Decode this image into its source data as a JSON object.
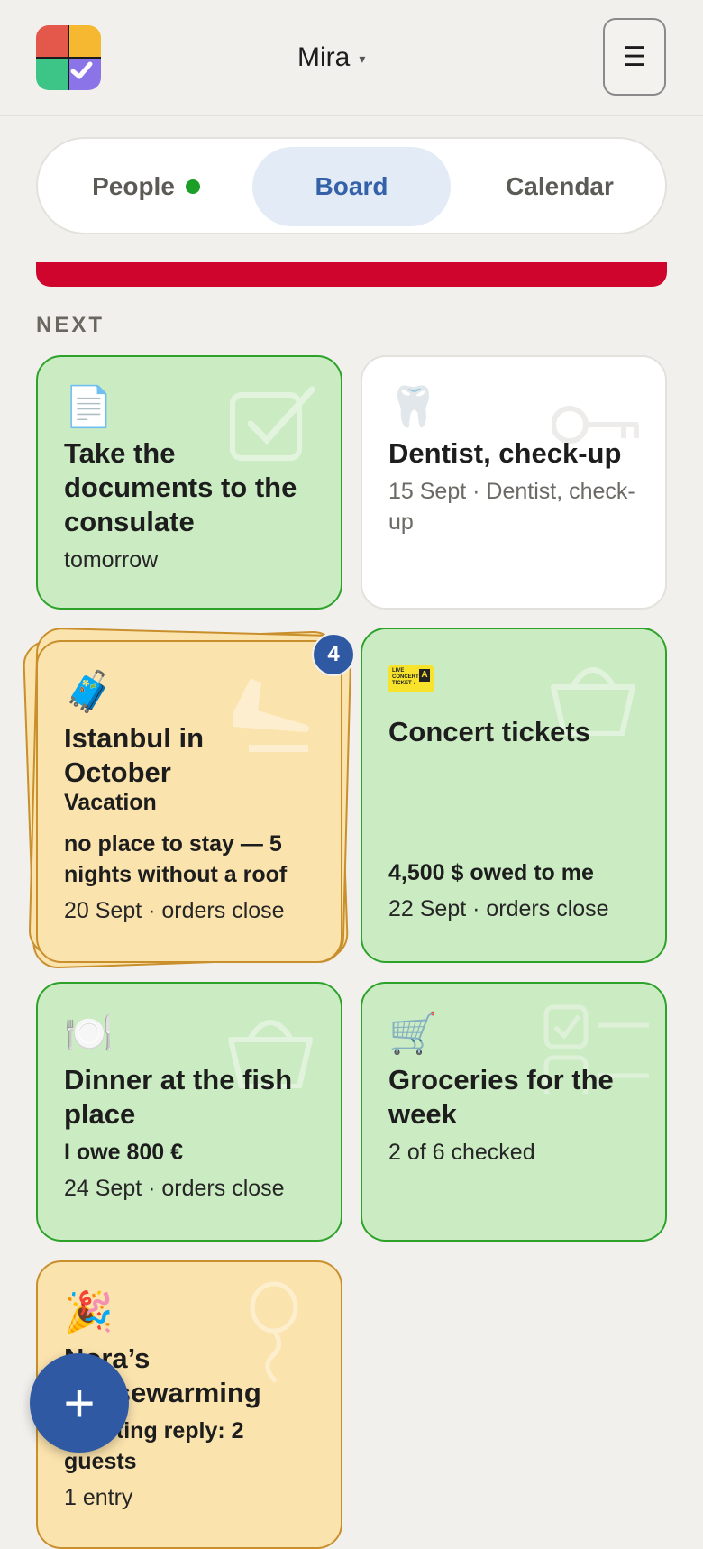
{
  "header": {
    "user_name": "Mira",
    "caret": "▾",
    "menu_icon": "☰"
  },
  "tabs": [
    {
      "label": "People",
      "status_dot_color": "#1c9f27"
    },
    {
      "label": "Board",
      "active": true
    },
    {
      "label": "Calendar"
    }
  ],
  "alert_bar_color": "#d0052d",
  "section_label": "NEXT",
  "cards": [
    {
      "emoji": "📄",
      "title": "Take the documents to the consulate",
      "meta": "tomorrow",
      "bg_icon": "checkbox-icon"
    },
    {
      "emoji": "🦷",
      "title": "Dentist, check-up",
      "meta": "15 Sept · Dentist, check-up",
      "bg_icon": "key-icon"
    },
    {
      "emoji": "🧳",
      "title": "Istanbul in October",
      "subtitle": "Vacation",
      "note": "no place to stay — 5 nights without a roof",
      "meta": "20 Sept · orders close",
      "badge": "4",
      "bg_icon": "plane-landing-icon"
    },
    {
      "ticket_lines": [
        "LIVE",
        "CONCERT",
        "TICKET ♪"
      ],
      "ticket_letter": "A",
      "title": "Concert tickets",
      "note": "4,500 $ owed to me",
      "meta": "22 Sept · orders close",
      "bg_icon": "basket-icon"
    },
    {
      "emoji": "🍽️",
      "title": "Dinner at the fish place",
      "note": "I owe 800 €",
      "meta": "24 Sept · orders close",
      "bg_icon": "basket-icon"
    },
    {
      "emoji": "🛒",
      "title": "Groceries for the week",
      "meta": "2 of 6 checked",
      "bg_icon": "checklist-icon"
    },
    {
      "emoji": "🎉",
      "title": "Nora’s housewarming",
      "note": "Awaiting reply: 2 guests",
      "meta": "1 entry",
      "bg_icon": "balloon-icon"
    }
  ],
  "fab_label": "+"
}
